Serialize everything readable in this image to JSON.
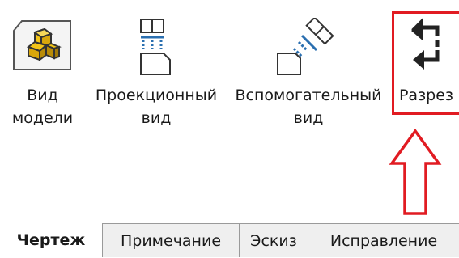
{
  "ribbon": {
    "tools": [
      {
        "line1": "Вид",
        "line2": "модели",
        "icon": "model-view-icon"
      },
      {
        "line1": "Проекционный",
        "line2": "вид",
        "icon": "projected-view-icon"
      },
      {
        "line1": "Вспомогательный",
        "line2": "вид",
        "icon": "auxiliary-view-icon"
      },
      {
        "line1": "Разрез",
        "line2": "",
        "icon": "section-view-icon"
      }
    ],
    "highlight_color": "#e11b22"
  },
  "annotation": {
    "icon": "up-arrow-outline-icon",
    "color": "#e11b22"
  },
  "tabs": [
    {
      "label": "Чертеж",
      "active": true
    },
    {
      "label": "Примечание",
      "active": false
    },
    {
      "label": "Эскиз",
      "active": false
    },
    {
      "label": "Исправление",
      "active": false
    }
  ],
  "colors": {
    "model_icon_fill": "#f2c418",
    "aux_icon_accent": "#2a6fb0",
    "tab_background": "#efefef"
  }
}
